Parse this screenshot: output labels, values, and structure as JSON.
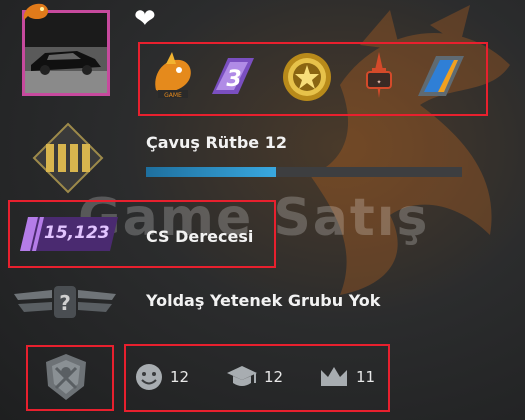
{
  "profile": {
    "heart_icon": "heart-icon",
    "avatar_desc_icon": "avatar-car-image"
  },
  "badges": [
    "dragon-badge-icon",
    "operation-badge-icon",
    "coin-badge-icon",
    "sword-badge-icon",
    "pin-badge-icon"
  ],
  "rank": {
    "title": "Çavuş Rütbe 12",
    "xp_progress": 0.41
  },
  "cs_rating": {
    "value": "15,123",
    "label": "CS Derecesi"
  },
  "skill": {
    "label": "Yoldaş Yetenek Grubu Yok"
  },
  "commendations": {
    "friendly": "12",
    "teacher": "12",
    "leader": "11"
  },
  "watermark": "Game Satış",
  "colors": {
    "red_box": "#e8202e",
    "xp_bar": "#39a8e0",
    "cs_rating_purple": "#8f4fc8",
    "avatar_border": "#c74a9e"
  }
}
